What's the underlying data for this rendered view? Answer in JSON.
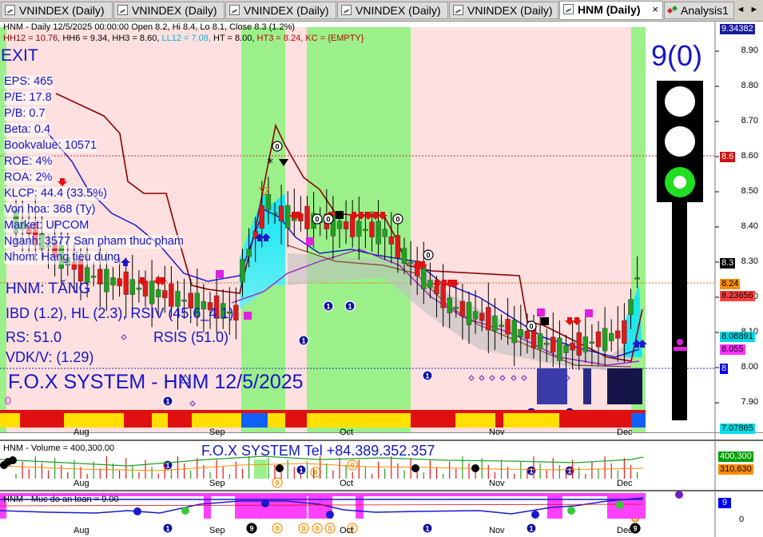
{
  "tabs": [
    {
      "label": "VNINDEX (Daily)",
      "active": false
    },
    {
      "label": "VNINDEX (Daily)",
      "active": false
    },
    {
      "label": "VNINDEX (Daily)",
      "active": false
    },
    {
      "label": "VNINDEX (Daily)",
      "active": false
    },
    {
      "label": "VNINDEX (Daily)",
      "active": false
    },
    {
      "label": "HNM (Daily)",
      "active": true
    },
    {
      "label": "Analysis1",
      "active": false
    }
  ],
  "tab_close": "×",
  "nav": {
    "prev": "◄",
    "next": "►"
  },
  "header": {
    "line1": "HNM - Daily 12/5/2025 00:00:00 Open 8.2, Hi 8.4, Lo 8.1, Close 8.3 (1.2%)",
    "line2": [
      {
        "text": "HH12 = 10.76, ",
        "color": "#8b0000"
      },
      {
        "text": "HH6 = 9.34, ",
        "color": "#000000"
      },
      {
        "text": "HH3 = 8.60, ",
        "color": "#000000"
      },
      {
        "text": "LL12 = 7.08, ",
        "color": "#00b4d8"
      },
      {
        "text": "HT = 8.00, ",
        "color": "#000000"
      },
      {
        "text": "HT3 = 8.24, ",
        "color": "#c00000"
      },
      {
        "text": "KC = {EMPTY}",
        "color": "#c00000"
      }
    ]
  },
  "signal": "EXIT",
  "fundamentals": [
    "EPS: 465",
    "P/E: 17.8",
    "P/B: 0.7",
    "Beta: 0.4",
    "Bookvalue: 10571",
    "ROE: 4%",
    "ROA: 2%",
    "KLCP: 44.4 (33.5%)",
    "Von hoa: 368 (Ty)",
    "Market: UPCOM",
    "Nganh: 3577 San pham thuc pham",
    "Nhom: Hang tieu dung"
  ],
  "status": {
    "trend": "HNM: TĂNG",
    "ibd": "IBD (1.2), HL (2.3), RSIV (45.6_4.1)",
    "rs": "RS: 51.0",
    "rsis": "RSIS (51.0)",
    "vdk": "VDK/V:  (1.29)",
    "zero": "0"
  },
  "watermark": "F.O.X SYSTEM - HNM 12/5/2025",
  "traffic": {
    "label": "9(0)",
    "colors": {
      "off": "#ffffff",
      "on": "#22dd22",
      "body": "#000000"
    }
  },
  "price_axis": {
    "ticks": [
      "8.90",
      "8.80",
      "8.70",
      "8.60",
      "8.50",
      "8.40",
      "8.30",
      "8.20",
      "8.10",
      "8.00",
      "7.90"
    ],
    "boxes": [
      {
        "text": "9.34382",
        "bg": "#1a1aa0",
        "fg": "#ffffff"
      },
      {
        "text": "8.6",
        "bg": "#d01010",
        "fg": "#ffffff"
      },
      {
        "text": "8.3",
        "bg": "#000000",
        "fg": "#ffffff"
      },
      {
        "text": "8.24",
        "bg": "#ff8c00",
        "fg": "#000000"
      },
      {
        "text": "8.23656",
        "bg": "#ff4040",
        "fg": "#000000"
      },
      {
        "text": "8.08891",
        "bg": "#00d8e8",
        "fg": "#000000"
      },
      {
        "text": "8.055",
        "bg": "#ff30ff",
        "fg": "#000000"
      },
      {
        "text": "8",
        "bg": "#0000ee",
        "fg": "#ffffff"
      },
      {
        "text": "7.07865",
        "bg": "#00e0e8",
        "fg": "#000000"
      }
    ]
  },
  "months": [
    "Aug",
    "Sep",
    "Oct",
    "Nov",
    "Dec"
  ],
  "volume": {
    "label": "HNM - Volume = 400,300.00",
    "tel": "F.O.X SYSTEM Tel +84.389.352.357",
    "box1": "400,300",
    "box2": "310,630"
  },
  "safety": {
    "label": "HNM - Muc do an toan = 9.00",
    "box": "9",
    "tick0": "0"
  },
  "chart_data": {
    "type": "candlestick",
    "title": "HNM - Daily 12/5/2025",
    "last": {
      "date": "12/5/2025",
      "open": 8.2,
      "high": 8.4,
      "low": 8.1,
      "close": 8.3,
      "change_pct": 1.2
    },
    "y_ticks": [
      8.9,
      8.8,
      8.7,
      8.6,
      8.5,
      8.4,
      8.3,
      8.2,
      8.1,
      8.0,
      7.9
    ],
    "ylim": [
      7.84,
      8.98
    ],
    "months": [
      "Aug",
      "Sep",
      "Oct",
      "Nov",
      "Dec"
    ],
    "levels": {
      "HH12": 10.76,
      "HH6": 9.34,
      "HH3": 8.6,
      "LL12": 7.08,
      "HT": 8.0,
      "HT3": 8.24
    },
    "volume_last": 400300,
    "volume_avg": 310630,
    "safety_level": 9
  }
}
